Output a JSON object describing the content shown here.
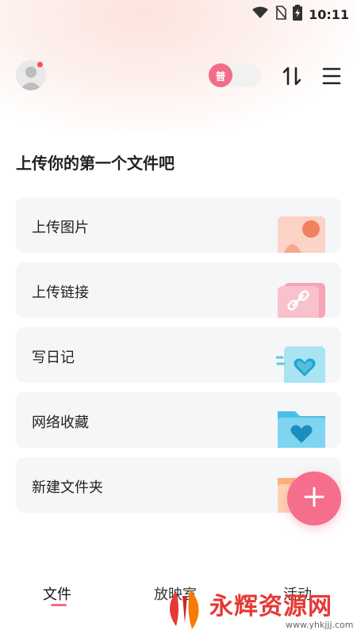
{
  "status_bar": {
    "time": "10:11",
    "icons": [
      "wifi-icon",
      "no-sim-icon",
      "battery-charging-icon"
    ]
  },
  "header": {
    "avatar": "avatar",
    "mode_toggle_label": "普",
    "icons": [
      "sort-icon",
      "menu-icon"
    ]
  },
  "main": {
    "title": "上传你的第一个文件吧",
    "cards": [
      {
        "label": "上传图片",
        "icon": "image-illustration"
      },
      {
        "label": "上传链接",
        "icon": "link-illustration"
      },
      {
        "label": "写日记",
        "icon": "diary-heart-illustration"
      },
      {
        "label": "网络收藏",
        "icon": "folder-heart-illustration"
      },
      {
        "label": "新建文件夹",
        "icon": "folder-illustration"
      }
    ],
    "fab_icon": "plus-icon"
  },
  "tabs": [
    {
      "label": "文件",
      "active": true
    },
    {
      "label": "放映室",
      "active": false
    },
    {
      "label": "活动",
      "active": false
    }
  ],
  "watermark": {
    "text": "永辉资源网",
    "url": "www.yhkjjj.com"
  },
  "colors": {
    "accent": "#f26d8a",
    "card_bg": "#f5f6f8"
  }
}
